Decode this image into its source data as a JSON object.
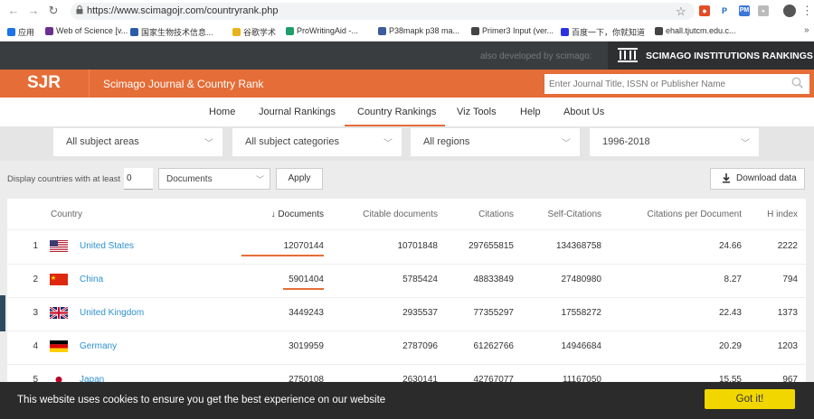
{
  "browser": {
    "url": "https://www.scimagojr.com/countryrank.php",
    "bookmarks": [
      {
        "label": "应用",
        "color": "#1a73e8"
      },
      {
        "label": "Web of Science [v...",
        "color": "#6b2f8f"
      },
      {
        "label": "国家生物技术信息...",
        "color": "#2a5caa"
      },
      {
        "label": "谷歌学术",
        "color": "#e8b31a"
      },
      {
        "label": "ProWritingAid -...",
        "color": "#1f9e6b"
      },
      {
        "label": "P38mapk p38 ma...",
        "color": "#3b5b9a"
      },
      {
        "label": "Primer3 Input (ver...",
        "color": "#444444"
      },
      {
        "label": "百度一下，你就知道",
        "color": "#2932e1"
      },
      {
        "label": "ehall.tjutcm.edu.c...",
        "color": "#444444"
      }
    ]
  },
  "site": {
    "dev_text": "also developed by scimago:",
    "sir_label": "SCIMAGO INSTITUTIONS RANKINGS",
    "logo": "SJR",
    "title": "Scimago Journal & Country Rank",
    "search_placeholder": "Enter Journal Title, ISSN or Publisher Name",
    "accent": "#e56d37"
  },
  "nav": [
    "Home",
    "Journal Rankings",
    "Country Rankings",
    "Viz Tools",
    "Help",
    "About Us"
  ],
  "filters": [
    "All subject areas",
    "All subject categories",
    "All regions",
    "1996-2018"
  ],
  "options": {
    "label": "Display countries with at least",
    "min_value": "0",
    "metric": "Documents",
    "apply": "Apply",
    "download": "Download data"
  },
  "table": {
    "headers": [
      "Country",
      "↓ Documents",
      "Citable documents",
      "Citations",
      "Self-Citations",
      "Citations per Document",
      "H index"
    ],
    "rows": [
      {
        "rank": "1",
        "country": "United States",
        "flag": "us",
        "documents": "12070144",
        "citable": "10701848",
        "citations": "297655815",
        "self": "134368758",
        "cpd": "24.66",
        "h": "2222",
        "bar": 1.0
      },
      {
        "rank": "2",
        "country": "China",
        "flag": "cn",
        "documents": "5901404",
        "citable": "5785424",
        "citations": "48833849",
        "self": "27480980",
        "cpd": "8.27",
        "h": "794",
        "bar": 0.49
      },
      {
        "rank": "3",
        "country": "United Kingdom",
        "flag": "gb",
        "documents": "3449243",
        "citable": "2935537",
        "citations": "77355297",
        "self": "17558272",
        "cpd": "22.43",
        "h": "1373",
        "bar": 0
      },
      {
        "rank": "4",
        "country": "Germany",
        "flag": "de",
        "documents": "3019959",
        "citable": "2787096",
        "citations": "61262766",
        "self": "14946684",
        "cpd": "20.29",
        "h": "1203",
        "bar": 0
      },
      {
        "rank": "5",
        "country": "Japan",
        "flag": "jp",
        "documents": "2750108",
        "citable": "2630141",
        "citations": "42767077",
        "self": "11167050",
        "cpd": "15.55",
        "h": "967",
        "bar": 0
      }
    ]
  },
  "cookie": {
    "text": "This website uses cookies to ensure you get the best experience on our website",
    "button": "Got it!"
  }
}
